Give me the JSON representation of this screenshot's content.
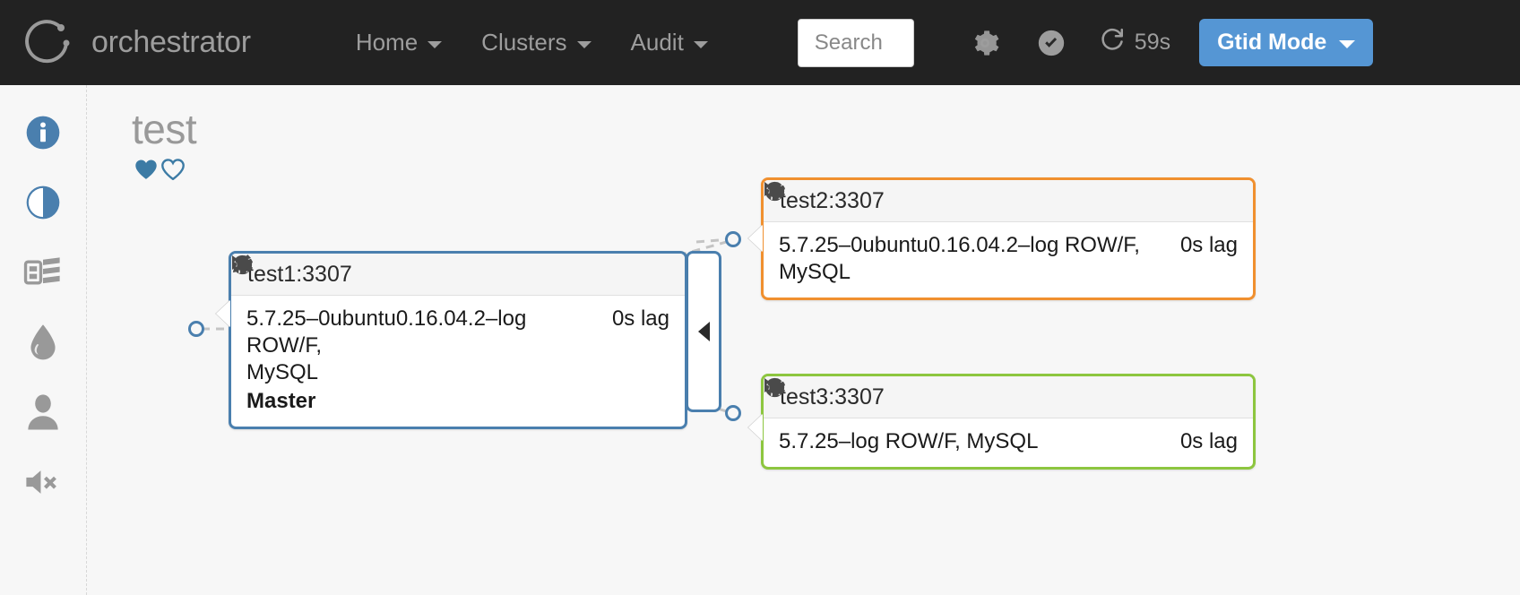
{
  "navbar": {
    "brand": "orchestrator",
    "logo_icon": "circle-arrow-logo",
    "links": [
      {
        "label": "Home",
        "icon": "chevron-down-icon"
      },
      {
        "label": "Clusters",
        "icon": "chevron-down-icon"
      },
      {
        "label": "Audit",
        "icon": "chevron-down-icon"
      }
    ],
    "search": {
      "value": "",
      "placeholder": "Search"
    },
    "icons": [
      {
        "name": "gear-icon",
        "glyph": "⚙"
      },
      {
        "name": "check-circle-icon",
        "glyph": "✔"
      }
    ],
    "refresh": {
      "icon": "refresh-icon",
      "label": "59s"
    },
    "gtid_button": {
      "label": "Gtid Mode",
      "icon": "caret-down-icon",
      "color": "#5596d4"
    }
  },
  "sidebar": {
    "items": [
      {
        "name": "info-icon",
        "label": "Info",
        "color": "#4a7fae"
      },
      {
        "name": "contrast-icon",
        "label": "Compact display",
        "color": "#4a7fae"
      },
      {
        "name": "table-list-icon",
        "label": "Instance details",
        "color": "#999999"
      },
      {
        "name": "droplet-icon",
        "label": "Pool",
        "color": "#999999"
      },
      {
        "name": "user-icon",
        "label": "Owner",
        "color": "#999999"
      },
      {
        "name": "mute-icon",
        "label": "Mute alerts",
        "color": "#999999"
      }
    ]
  },
  "main": {
    "cluster_title": "test",
    "hearts": [
      {
        "name": "heart-filled-icon",
        "filled": true,
        "color": "#3c7ba5"
      },
      {
        "name": "heart-outline-icon",
        "filled": false,
        "color": "#3c7ba5"
      }
    ],
    "collapse_handle": {
      "name": "collapse-handle",
      "icon": "chevron-left-icon"
    },
    "nodes": [
      {
        "id": "test1",
        "title": "test1:3307",
        "border_color": "#4a7fae",
        "version": "5.7.25–0ubuntu0.16.04.2–log ROW/F,",
        "flavor": "MySQL",
        "lag": "0s lag",
        "role": "Master",
        "icons": [
          {
            "name": "fast-forward-icon"
          },
          {
            "name": "pencil-icon"
          },
          {
            "name": "globe-icon"
          },
          {
            "name": "gear-icon"
          }
        ]
      },
      {
        "id": "test2",
        "title": "test2:3307",
        "border_color": "#f0902f",
        "version": "5.7.25–0ubuntu0.16.04.2–log ROW/F,",
        "flavor": "MySQL",
        "lag": "0s lag",
        "role": "",
        "icons": [
          {
            "name": "fast-forward-icon"
          },
          {
            "name": "globe-icon"
          },
          {
            "name": "gear-icon"
          }
        ]
      },
      {
        "id": "test3",
        "title": "test3:3307",
        "border_color": "#8dc63f",
        "version": "5.7.25–log ROW/F, MySQL",
        "flavor": "",
        "lag": "0s lag",
        "role": "",
        "icons": [
          {
            "name": "fast-forward-icon"
          },
          {
            "name": "globe-icon"
          },
          {
            "name": "gear-icon"
          }
        ]
      }
    ]
  }
}
